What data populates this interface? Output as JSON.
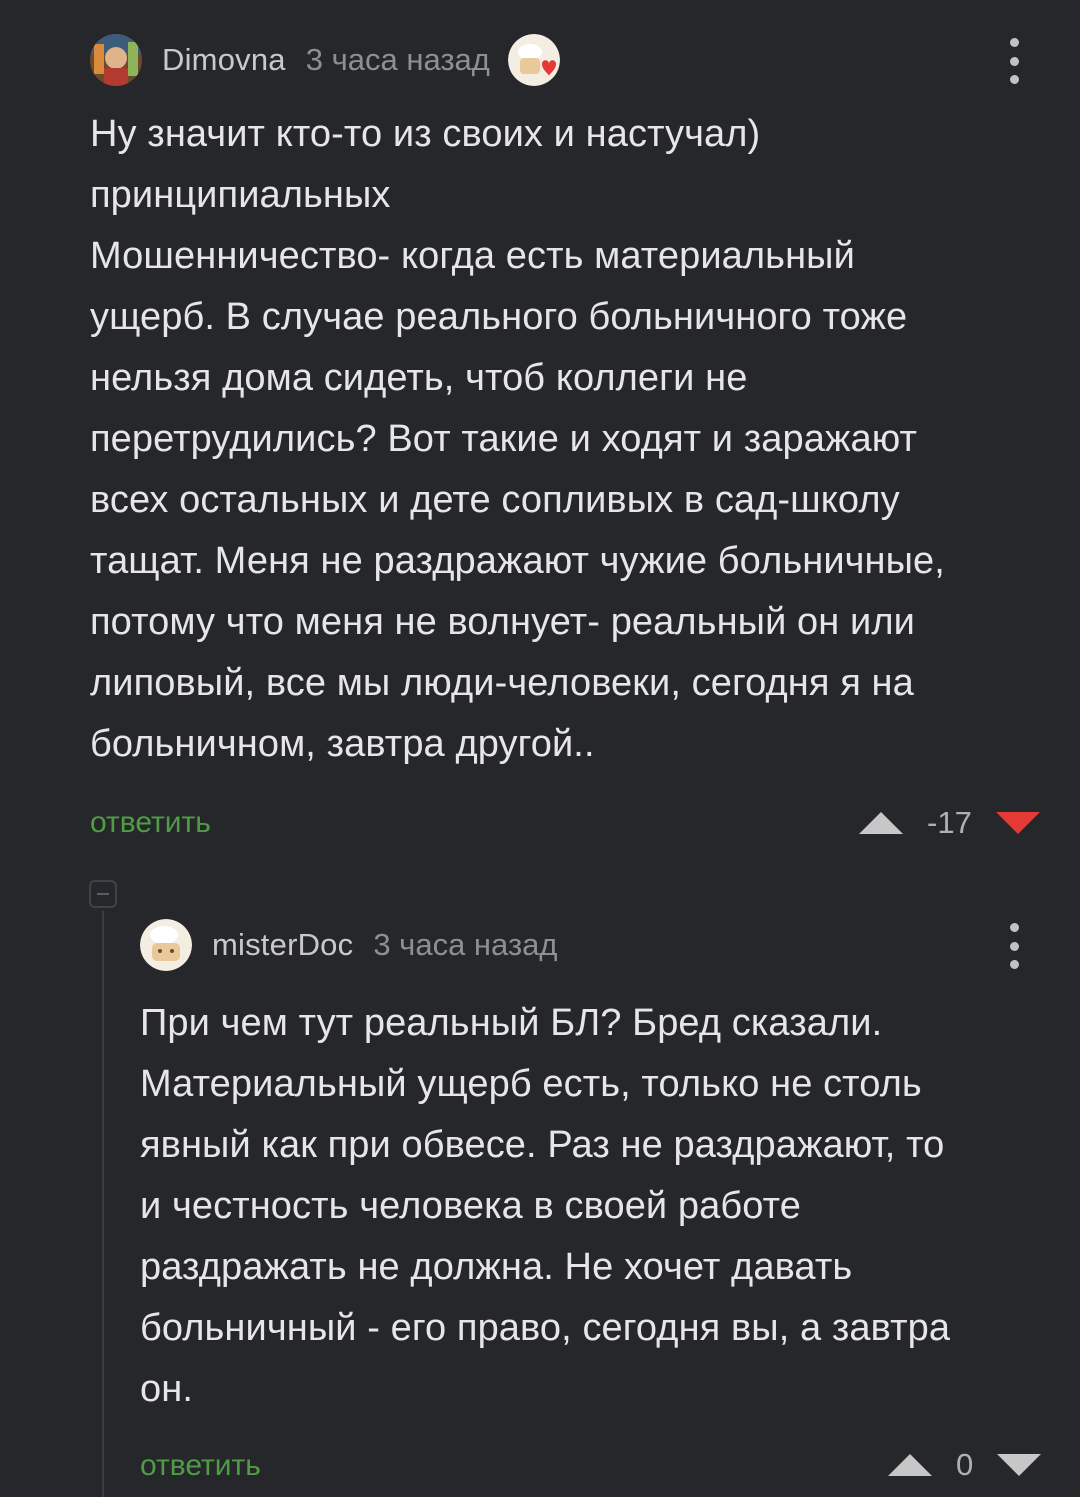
{
  "comment1": {
    "author": "Dimovna",
    "time": "3 часа назад",
    "body": "Ну значит кто-то из своих и настучал)\nпринципиальных\nМошенничество- когда есть материальный\nущерб. В случае реального больничного тоже\nнельзя дома сидеть, чтоб коллеги не\nперетрудились? Вот такие и ходят и заражают\nвсех остальных и дете сопливых в сад-школу\nтащат. Меня не раздражают чужие больничные,\nпотому что меня не волнует- реальный он или\nлиповый, все мы люди-человеки, сегодня я на\nбольничном, завтра другой..",
    "reply_label": "ответить",
    "rating": "-17"
  },
  "comment2": {
    "author": "misterDoc",
    "time": "3 часа назад",
    "body": "При чем тут реальный БЛ? Бред сказали.\nМатериальный ущерб есть, только не столь\nявный как при обвесе. Раз не раздражают, то\nи честность человека в своей работе\nраздражать не должна. Не хочет давать\nбольничный - его право, сегодня вы, а завтра\nон.",
    "reply_label": "ответить",
    "rating": "0"
  },
  "colors": {
    "background": "#25272b",
    "reply_link": "#4f9c45",
    "downvote_active": "#e53935",
    "vote_inactive": "#c7c7c7"
  },
  "icons": {
    "menu": "more-vertical-icon",
    "upvote": "triangle-up-icon",
    "downvote": "triangle-down-icon",
    "badge": "heart-badge-icon",
    "collapse": "collapse-minus-icon"
  }
}
